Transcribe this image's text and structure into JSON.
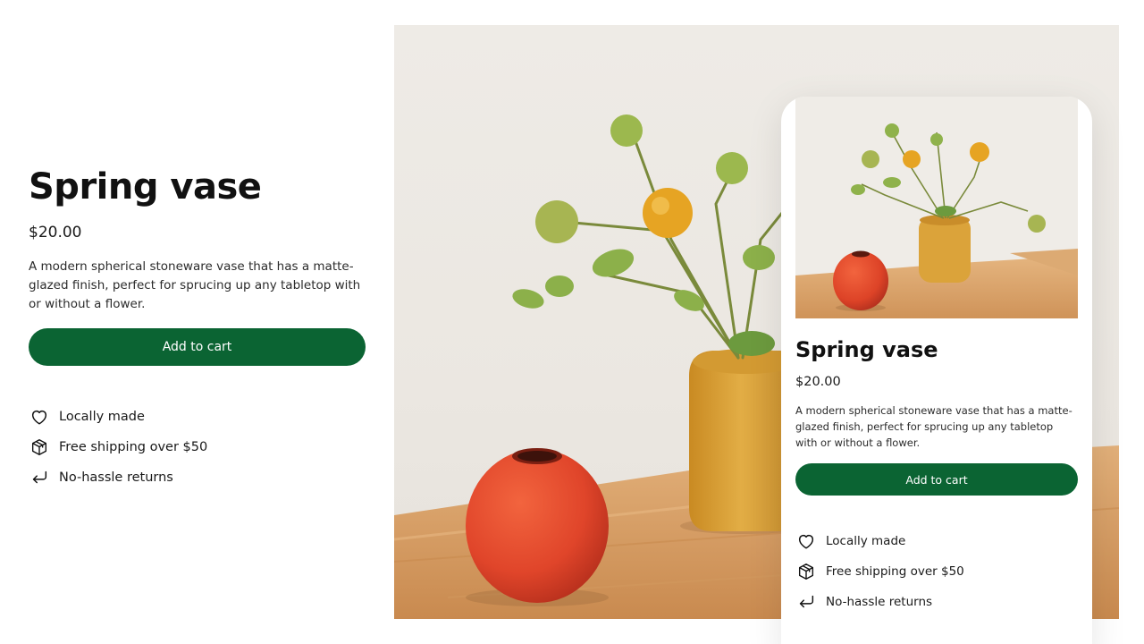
{
  "product": {
    "title": "Spring vase",
    "price": "$20.00",
    "description": "A modern spherical stoneware vase that has a matte-glazed finish, perfect for sprucing up any tabletop with or without a flower.",
    "add_to_cart_label": "Add to cart"
  },
  "features": [
    {
      "icon": "heart-icon",
      "label": "Locally made"
    },
    {
      "icon": "package-icon",
      "label": "Free shipping over $50"
    },
    {
      "icon": "return-arrow-icon",
      "label": "No-hassle returns"
    }
  ],
  "mobile_preview": {
    "title": "Spring vase",
    "price": "$20.00",
    "description": "A modern spherical stoneware vase that has a matte-glazed finish, perfect for sprucing up any tabletop with or without a flower.",
    "add_to_cart_label": "Add to cart",
    "features": [
      {
        "icon": "heart-icon",
        "label": "Locally made"
      },
      {
        "icon": "package-icon",
        "label": "Free shipping over $50"
      },
      {
        "icon": "return-arrow-icon",
        "label": "No-hassle returns"
      }
    ]
  },
  "colors": {
    "button": "#0b6433",
    "red_vase": "#e0452a",
    "yellow_vase": "#dba33a",
    "table": "#d8a065"
  }
}
